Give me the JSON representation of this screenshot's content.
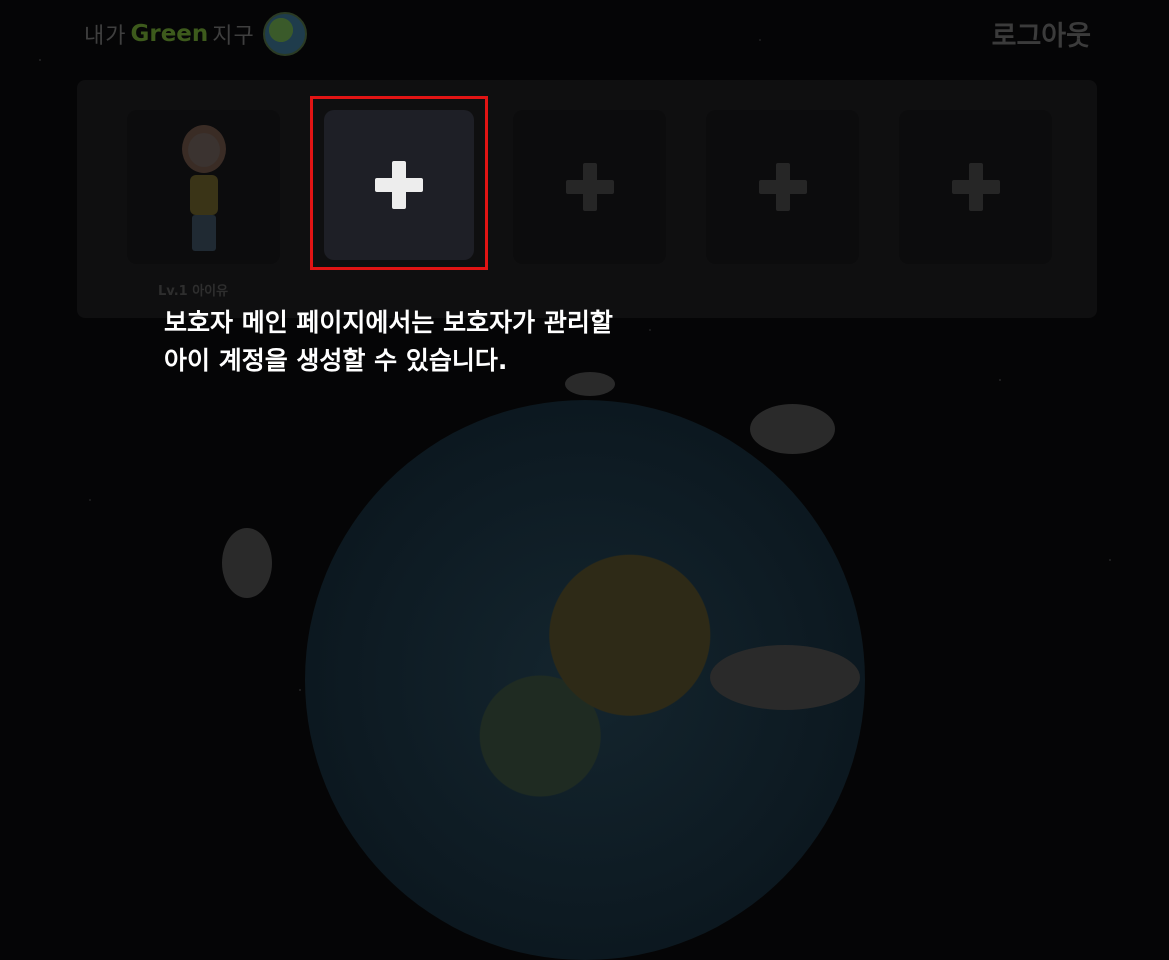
{
  "header": {
    "logo_prefix": "내가",
    "logo_green": "Green",
    "logo_suffix": "지구",
    "logout_label": "로그아웃"
  },
  "children": [
    {
      "label": "Lv.1 아이유",
      "type": "avatar"
    },
    {
      "type": "add",
      "highlighted": true
    },
    {
      "type": "add"
    },
    {
      "type": "add"
    },
    {
      "type": "add"
    }
  ],
  "instruction": {
    "line1": "보호자 메인 페이지에서는 보호자가  관리할",
    "line2": "아이 계정을 생성할 수 있습니다."
  },
  "colors": {
    "highlight_border": "#e11414",
    "background": "#050506"
  },
  "icons": {
    "add": "plus-icon",
    "logo": "earth-globe-icon"
  }
}
